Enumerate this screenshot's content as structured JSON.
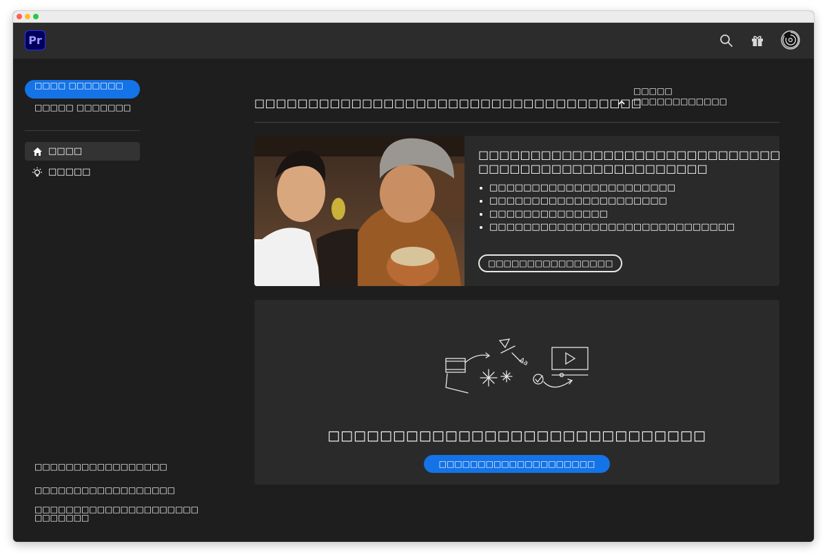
{
  "app": {
    "logo_text": "Pr",
    "colors": {
      "accent": "#1473e6",
      "background": "#1e1e1e",
      "header": "#2c2c2c",
      "card": "#2a2a2a",
      "logo_bg": "#00005b",
      "logo_text": "#9999ff"
    }
  },
  "header": {
    "icons": [
      "search-icon",
      "gift-icon",
      "profile-avatar-icon"
    ]
  },
  "sidebar": {
    "tabs": [
      {
        "label": "□□□□ □□□□□□□",
        "active": true
      },
      {
        "label": "□□□□□ □□□□□□□",
        "active": false
      }
    ],
    "nav": [
      {
        "label": "□□□□",
        "icon": "home-icon",
        "selected": true
      },
      {
        "label": "□□□□□",
        "icon": "lightbulb-icon",
        "selected": false
      }
    ],
    "footer_links": [
      "□□□□□□□□□□□□□□□□□",
      "□□□□□□□□□□□□□□□□□□",
      "□□□□□□□□□□□□□□□□□□□□□ □□□□□□□"
    ]
  },
  "main": {
    "title": "□□□□□□□□□□□□□□□□□□□□□□□□□□□□□□□□□□□□",
    "collapse_label": "□□□□□ □□□□□□□□□□□□",
    "collapse_icon": "chevron-up-icon",
    "feature_card": {
      "title": "□□□□□□□□□□□□□□□□□□□□□□□□□□□□□ □□□□□□□□□□□□□□□□□□□□□□",
      "bullets": [
        "□□□□□□□□□□□□□□□□□□□□□□",
        "□□□□□□□□□□□□□□□□□□□□□",
        "□□□□□□□□□□□□□□",
        "□□□□□□□□□□□□□□□□□□□□□□□□□□□□□"
      ],
      "button_label": "□□□□□□□□□□□□□□□□"
    },
    "empty_card": {
      "title": "□□□□□□□□□□□□□□□□□□□□□□□□□□□□□",
      "button_label": "□□□□□□□□□□□□□□□□□□□□"
    }
  }
}
